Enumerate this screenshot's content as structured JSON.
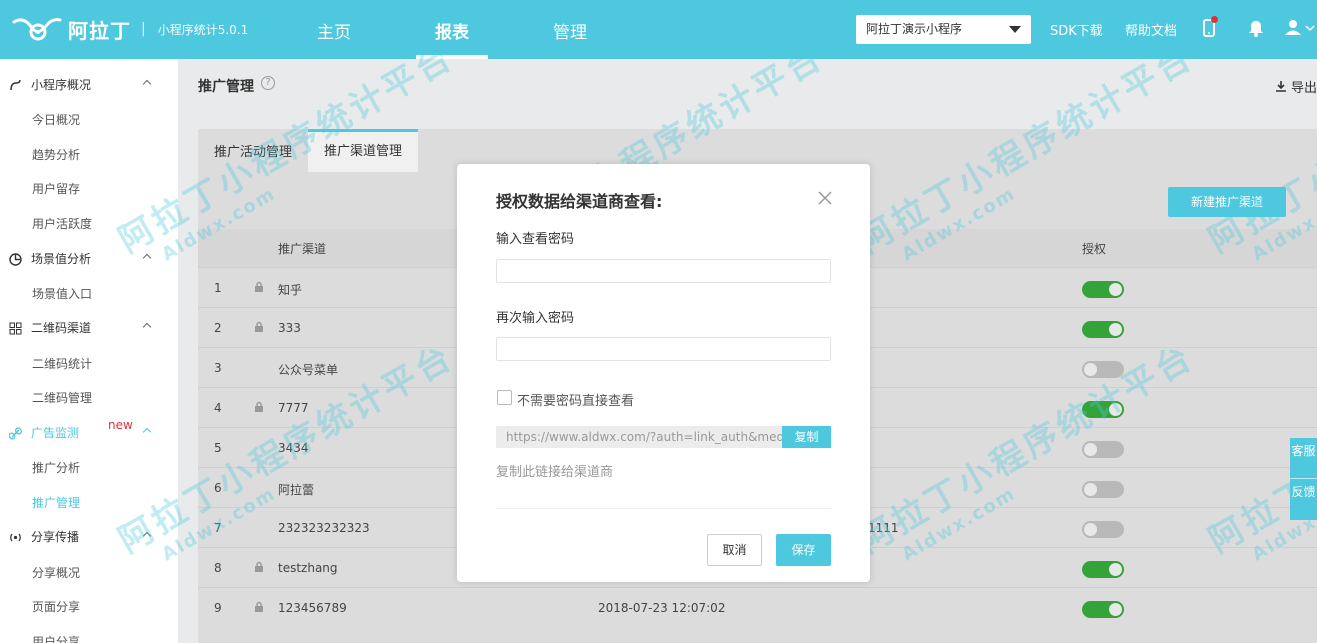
{
  "header": {
    "brand": "阿拉丁",
    "separator": "|",
    "subtitle": "小程序统计5.0.1",
    "nav": [
      {
        "label": "主页"
      },
      {
        "label": "报表"
      },
      {
        "label": "管理"
      }
    ],
    "active_nav": "报表",
    "app_select": "阿拉丁演示小程序",
    "sdk_link": "SDK下载",
    "docs_link": "帮助文档",
    "icons": [
      "phone-icon",
      "bell-icon",
      "user-icon"
    ]
  },
  "sidebar": {
    "items": [
      {
        "type": "group",
        "label": "小程序概况",
        "icon": "overview-icon"
      },
      {
        "type": "sub",
        "label": "今日概况"
      },
      {
        "type": "sub",
        "label": "趋势分析"
      },
      {
        "type": "sub",
        "label": "用户留存"
      },
      {
        "type": "sub",
        "label": "用户活跃度"
      },
      {
        "type": "group",
        "label": "场景值分析",
        "icon": "pie-icon"
      },
      {
        "type": "sub",
        "label": "场景值入口"
      },
      {
        "type": "group",
        "label": "二维码渠道",
        "icon": "qrcode-icon"
      },
      {
        "type": "sub",
        "label": "二维码统计"
      },
      {
        "type": "sub",
        "label": "二维码管理"
      },
      {
        "type": "group",
        "label": "广告监测",
        "icon": "link-icon",
        "badge": "new"
      },
      {
        "type": "sub",
        "label": "推广分析"
      },
      {
        "type": "sub",
        "label": "推广管理"
      },
      {
        "type": "group",
        "label": "分享传播",
        "icon": "share-icon"
      },
      {
        "type": "sub",
        "label": "分享概况"
      },
      {
        "type": "sub",
        "label": "页面分享"
      },
      {
        "type": "sub",
        "label": "用户分享"
      }
    ]
  },
  "page": {
    "title": "推广管理",
    "help": "?",
    "export": "导出"
  },
  "tabs": [
    {
      "label": "推广活动管理"
    },
    {
      "label": "推广渠道管理"
    }
  ],
  "new_channel_button": "新建推广渠道",
  "table": {
    "headers": {
      "channel": "推广渠道",
      "auth": "授权"
    },
    "rows": [
      {
        "idx": "1",
        "lock": true,
        "name": "知乎",
        "time": "",
        "tail": "",
        "auth": true
      },
      {
        "idx": "2",
        "lock": true,
        "name": "333",
        "time": "",
        "tail": "",
        "auth": true
      },
      {
        "idx": "3",
        "lock": false,
        "name": "公众号菜单",
        "time": "",
        "tail": "",
        "auth": false
      },
      {
        "idx": "4",
        "lock": true,
        "name": "7777",
        "time": "",
        "tail": "",
        "auth": true
      },
      {
        "idx": "5",
        "lock": false,
        "name": "3434",
        "time": "",
        "tail": "",
        "auth": false
      },
      {
        "idx": "6",
        "lock": false,
        "name": "阿拉蕾",
        "time": "",
        "tail": "",
        "auth": false
      },
      {
        "idx": "7",
        "lock": false,
        "name": "232323232323",
        "time": "",
        "tail": "1111",
        "auth": false
      },
      {
        "idx": "8",
        "lock": true,
        "name": "testzhang",
        "time": "",
        "tail": "",
        "auth": true
      },
      {
        "idx": "9",
        "lock": true,
        "name": "123456789",
        "time": "2018-07-23 12:07:02",
        "tail": "",
        "auth": true
      }
    ]
  },
  "watermark": {
    "text": "阿拉丁小程序统计平台",
    "sub": "Aldwx.com"
  },
  "modal": {
    "title": "授权数据给渠道商查看:",
    "password_label": "输入查看密码",
    "password_value": "",
    "confirm_label": "再次输入密码",
    "confirm_value": "",
    "no_password_label": "不需要密码直接查看",
    "link_value": "https://www.aldwx.com/?auth=link_auth&media",
    "copy_button": "复制",
    "hint": "复制此链接给渠道商",
    "cancel_button": "取消",
    "save_button": "保存"
  },
  "float_service": {
    "service": "客服",
    "feedback": "反馈"
  },
  "colors": {
    "accent": "#4ec8de",
    "toggle_on": "#33a33a",
    "new_badge": "#e0323a"
  }
}
